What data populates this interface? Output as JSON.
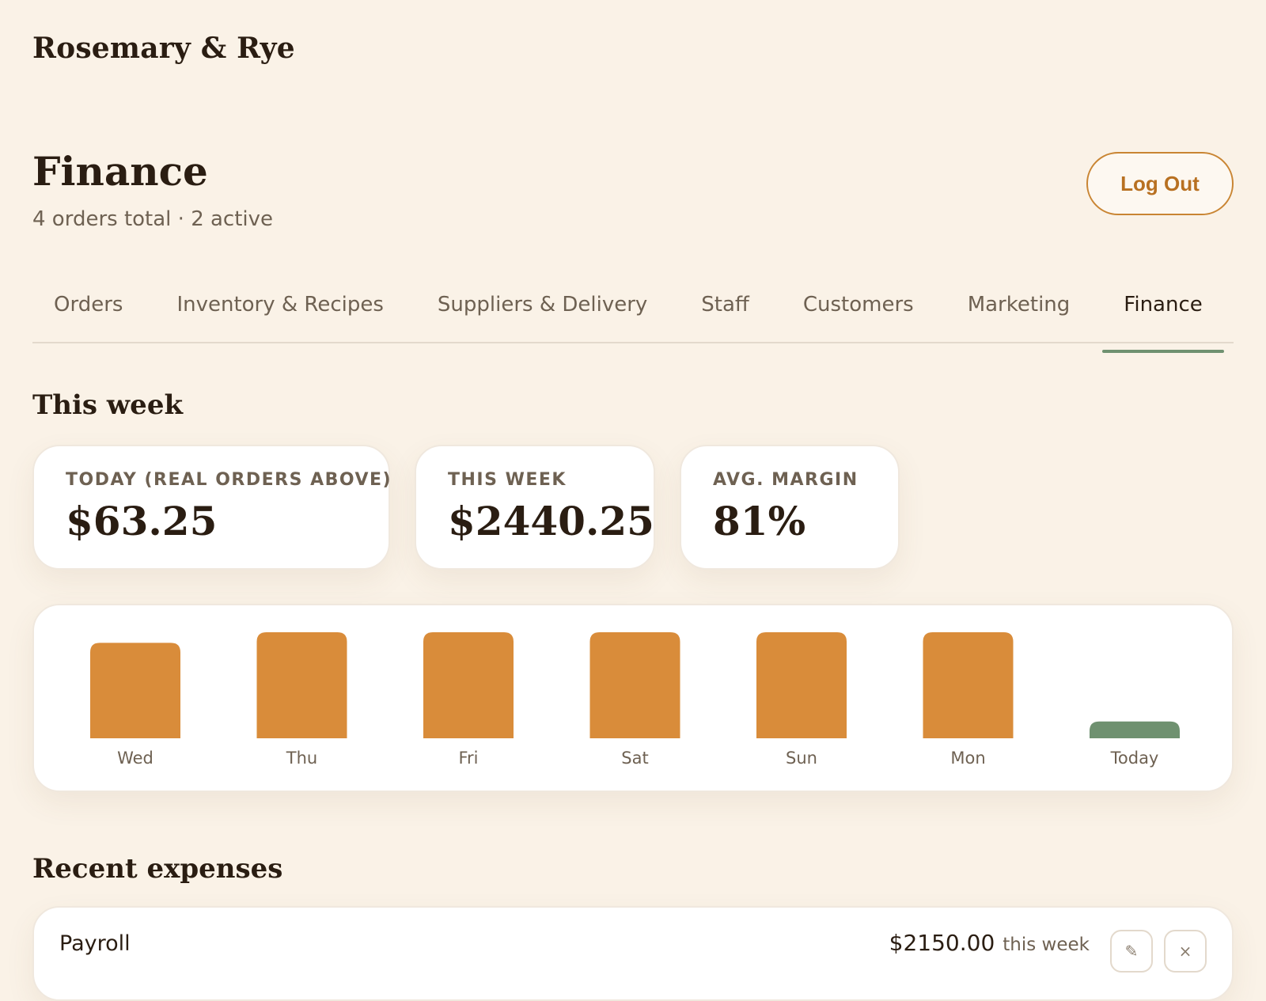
{
  "brand": "Rosemary & Rye",
  "header": {
    "title": "Finance",
    "subtitle": "4 orders total · 2 active",
    "logout_label": "Log Out"
  },
  "tabs": [
    {
      "label": "Orders"
    },
    {
      "label": "Inventory & Recipes"
    },
    {
      "label": "Suppliers & Delivery"
    },
    {
      "label": "Staff"
    },
    {
      "label": "Customers"
    },
    {
      "label": "Marketing"
    },
    {
      "label": "Finance",
      "active": true
    }
  ],
  "this_week": {
    "title": "This week",
    "stats": [
      {
        "label": "TODAY (REAL ORDERS ABOVE)",
        "value": "$63.25"
      },
      {
        "label": "THIS WEEK",
        "value": "$2440.25"
      },
      {
        "label": "AVG. MARGIN",
        "value": "81%"
      }
    ]
  },
  "chart_data": {
    "type": "bar",
    "categories": [
      "Wed",
      "Thu",
      "Fri",
      "Sat",
      "Sun",
      "Mon",
      "Today"
    ],
    "values": [
      360,
      400,
      400,
      400,
      400,
      400,
      63.25
    ],
    "ylim": [
      0,
      400
    ],
    "grid": false,
    "colors": {
      "default": "#d98c3a",
      "today": "#6f9170"
    }
  },
  "expenses": {
    "title": "Recent expenses",
    "items": [
      {
        "name": "Payroll",
        "amount": "$2150.00",
        "period": "this week"
      }
    ]
  },
  "icons": {
    "edit": "pencil-icon",
    "delete": "close-icon"
  }
}
